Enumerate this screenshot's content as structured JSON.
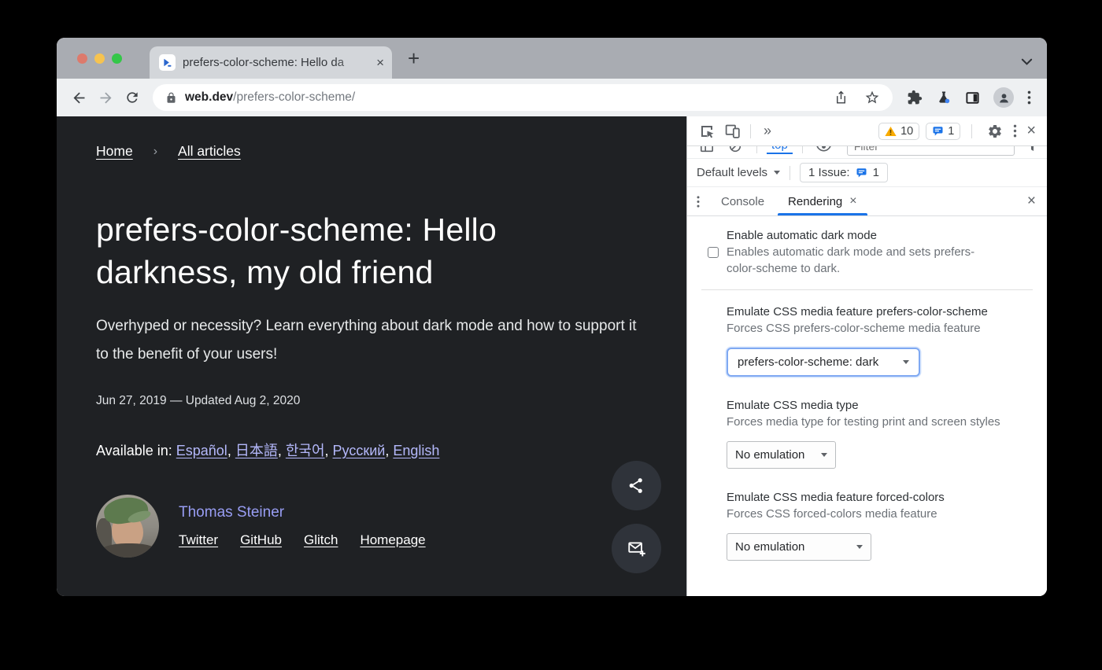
{
  "glyphs": {
    "close": "×",
    "new_tab": "+",
    "more_tabs": "»"
  },
  "browser": {
    "tab_title": "prefers-color-scheme: Hello da",
    "url_domain": "web.dev",
    "url_path": "/prefers-color-scheme/"
  },
  "page": {
    "breadcrumb": {
      "home": "Home",
      "sep": "›",
      "articles": "All articles"
    },
    "title": "prefers-color-scheme: Hello darkness, my old friend",
    "subtitle": "Overhyped or necessity? Learn everything about dark mode and how to support it to the benefit of your users!",
    "date": "Jun 27, 2019 — Updated Aug 2, 2020",
    "available_label": "Available in:",
    "languages": [
      "Español",
      "日本語",
      "한국어",
      "Русский",
      "English"
    ],
    "author_name": "Thomas Steiner",
    "author_links": [
      "Twitter",
      "GitHub",
      "Glitch",
      "Homepage"
    ]
  },
  "devtools": {
    "warning_count": "10",
    "message_count": "1",
    "context": "top",
    "filter_placeholder": "Filter",
    "levels_label": "Default levels",
    "issue_label": "1 Issue:",
    "issue_count": "1",
    "tabs": {
      "console": "Console",
      "rendering": "Rendering"
    },
    "rendering": {
      "auto_dark": {
        "title": "Enable automatic dark mode",
        "desc": "Enables automatic dark mode and sets prefers-color-scheme to dark."
      },
      "prefers_color_scheme": {
        "title": "Emulate CSS media feature prefers-color-scheme",
        "desc": "Forces CSS prefers-color-scheme media feature",
        "value": "prefers-color-scheme: dark"
      },
      "media_type": {
        "title": "Emulate CSS media type",
        "desc": "Forces media type for testing print and screen styles",
        "value": "No emulation"
      },
      "forced_colors": {
        "title": "Emulate CSS media feature forced-colors",
        "desc": "Forces CSS forced-colors media feature",
        "value": "No emulation"
      }
    }
  },
  "colors": {
    "accent_blue": "#1a73e8",
    "warning_yellow": "#f9ab00",
    "page_bg": "#1f2124",
    "link_lavender": "#b4b8fb",
    "author_lavender": "#989df3"
  }
}
